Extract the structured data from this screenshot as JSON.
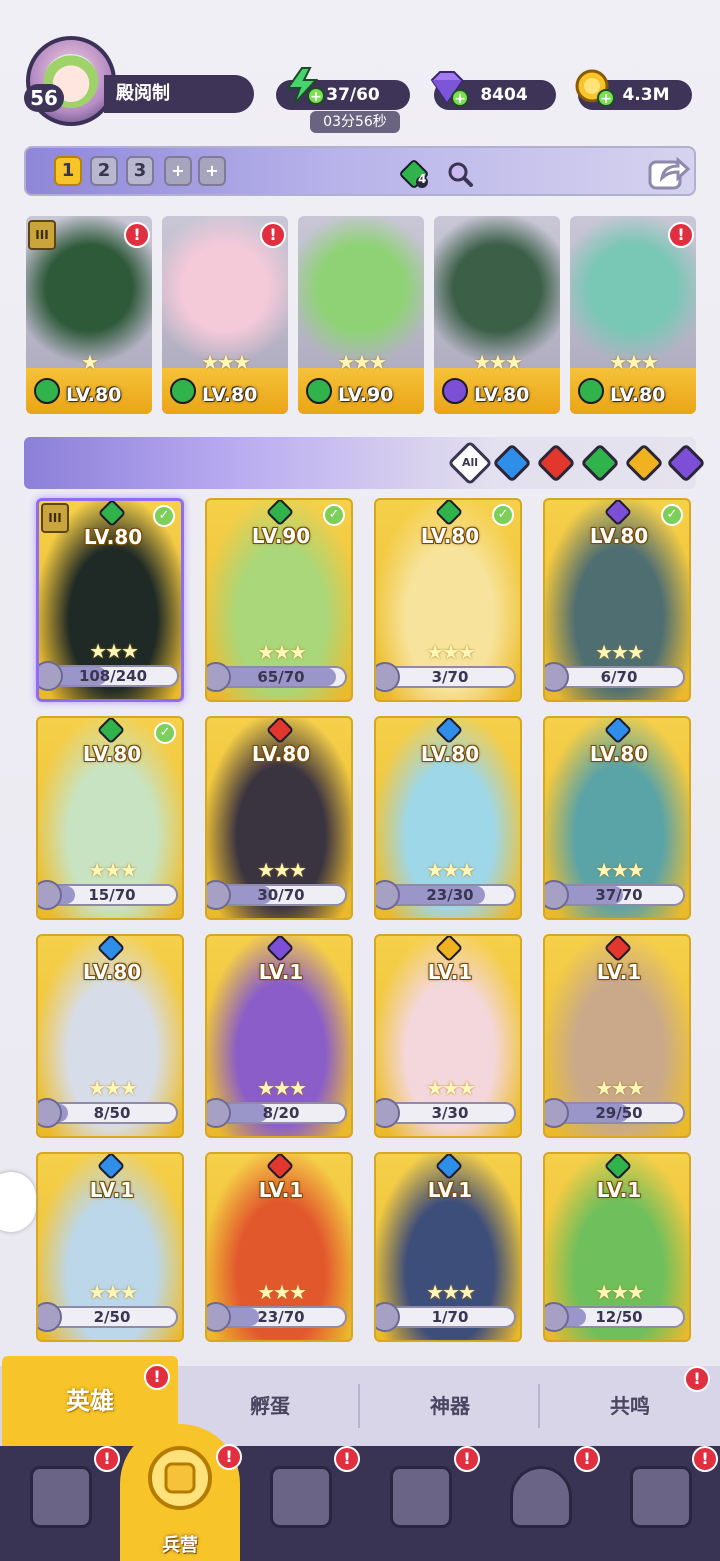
{
  "player": {
    "level": "56",
    "name": "殿阅制"
  },
  "resources": {
    "energy": "37/60",
    "energy_timer": "03分56秒",
    "gems": "8404",
    "gold": "4.3M"
  },
  "team_tabs": [
    {
      "label": "1",
      "active": true
    },
    {
      "label": "2",
      "active": false
    },
    {
      "label": "3",
      "active": false
    },
    {
      "label": "+",
      "active": false
    },
    {
      "label": "+",
      "active": false
    }
  ],
  "team_gem_count": "4",
  "team": [
    {
      "level": "LV.80",
      "element": "nature",
      "stars": 1,
      "alert": true,
      "rank": "III",
      "art": "#2f5a3a"
    },
    {
      "level": "LV.80",
      "element": "nature",
      "stars": 3,
      "alert": true,
      "art": "#f4c9d8"
    },
    {
      "level": "LV.90",
      "element": "nature",
      "stars": 3,
      "alert": false,
      "art": "#8fd276"
    },
    {
      "level": "LV.80",
      "element": "dark",
      "stars": 3,
      "alert": false,
      "art": "#3b5f47"
    },
    {
      "level": "LV.80",
      "element": "nature",
      "stars": 3,
      "alert": true,
      "art": "#79c7b5"
    }
  ],
  "filters": {
    "all_label": "All",
    "elements": [
      {
        "name": "water",
        "color": "#2f8fe8"
      },
      {
        "name": "fire",
        "color": "#e2372c"
      },
      {
        "name": "nature",
        "color": "#2fb34a"
      },
      {
        "name": "light",
        "color": "#f0b21f"
      },
      {
        "name": "dark",
        "color": "#7c4fd6"
      }
    ]
  },
  "heroes": [
    {
      "level": "LV.80",
      "element": "nature",
      "progress": "108/240",
      "ratio": 0.45,
      "checked": true,
      "selected": true,
      "rank": "III",
      "art": "#1f2a26"
    },
    {
      "level": "LV.90",
      "element": "nature",
      "progress": "65/70",
      "ratio": 0.93,
      "checked": true,
      "art": "#a9d77a"
    },
    {
      "level": "LV.80",
      "element": "nature",
      "progress": "3/70",
      "ratio": 0.04,
      "checked": true,
      "art": "#f7e39b"
    },
    {
      "level": "LV.80",
      "element": "dark",
      "progress": "6/70",
      "ratio": 0.09,
      "checked": true,
      "art": "#4f6e72"
    },
    {
      "level": "LV.80",
      "element": "nature",
      "progress": "15/70",
      "ratio": 0.21,
      "checked": true,
      "art": "#c8e3c2"
    },
    {
      "level": "LV.80",
      "element": "fire",
      "progress": "30/70",
      "ratio": 0.43,
      "checked": false,
      "art": "#3a3340"
    },
    {
      "level": "LV.80",
      "element": "water",
      "progress": "23/30",
      "ratio": 0.77,
      "checked": false,
      "art": "#9ed7e8"
    },
    {
      "level": "LV.80",
      "element": "water",
      "progress": "37/70",
      "ratio": 0.53,
      "checked": false,
      "art": "#5aa3a7"
    },
    {
      "level": "LV.80",
      "element": "water",
      "progress": "8/50",
      "ratio": 0.16,
      "checked": false,
      "art": "#d7dde8"
    },
    {
      "level": "LV.1",
      "element": "dark",
      "progress": "8/20",
      "ratio": 0.4,
      "checked": false,
      "art": "#8a5dc8"
    },
    {
      "level": "LV.1",
      "element": "light",
      "progress": "3/30",
      "ratio": 0.1,
      "checked": false,
      "art": "#f4d7dc"
    },
    {
      "level": "LV.1",
      "element": "fire",
      "progress": "29/50",
      "ratio": 0.58,
      "checked": false,
      "art": "#c9a98a"
    },
    {
      "level": "LV.1",
      "element": "water",
      "progress": "2/50",
      "ratio": 0.04,
      "checked": false,
      "art": "#bcd7ea"
    },
    {
      "level": "LV.1",
      "element": "fire",
      "progress": "23/70",
      "ratio": 0.33,
      "checked": false,
      "art": "#e2582d"
    },
    {
      "level": "LV.1",
      "element": "water",
      "progress": "1/70",
      "ratio": 0.02,
      "checked": false,
      "art": "#3e4e7a"
    },
    {
      "level": "LV.1",
      "element": "nature",
      "progress": "12/50",
      "ratio": 0.24,
      "checked": false,
      "art": "#6fbf5c"
    }
  ],
  "sub_tabs": [
    {
      "label": "英雄",
      "active": true,
      "alert": true
    },
    {
      "label": "孵蛋",
      "active": false,
      "alert": false
    },
    {
      "label": "神器",
      "active": false,
      "alert": false
    },
    {
      "label": "共鸣",
      "active": false,
      "alert": true
    }
  ],
  "nav": [
    {
      "icon": "cards-icon",
      "label": "",
      "alert": true
    },
    {
      "icon": "barracks-icon",
      "label": "兵营",
      "alert": true,
      "active": true
    },
    {
      "icon": "map-icon",
      "label": "",
      "alert": true
    },
    {
      "icon": "castle-icon",
      "label": "",
      "alert": true
    },
    {
      "icon": "guild-icon",
      "label": "",
      "alert": true
    },
    {
      "icon": "shield-icon",
      "label": "",
      "alert": true
    }
  ]
}
